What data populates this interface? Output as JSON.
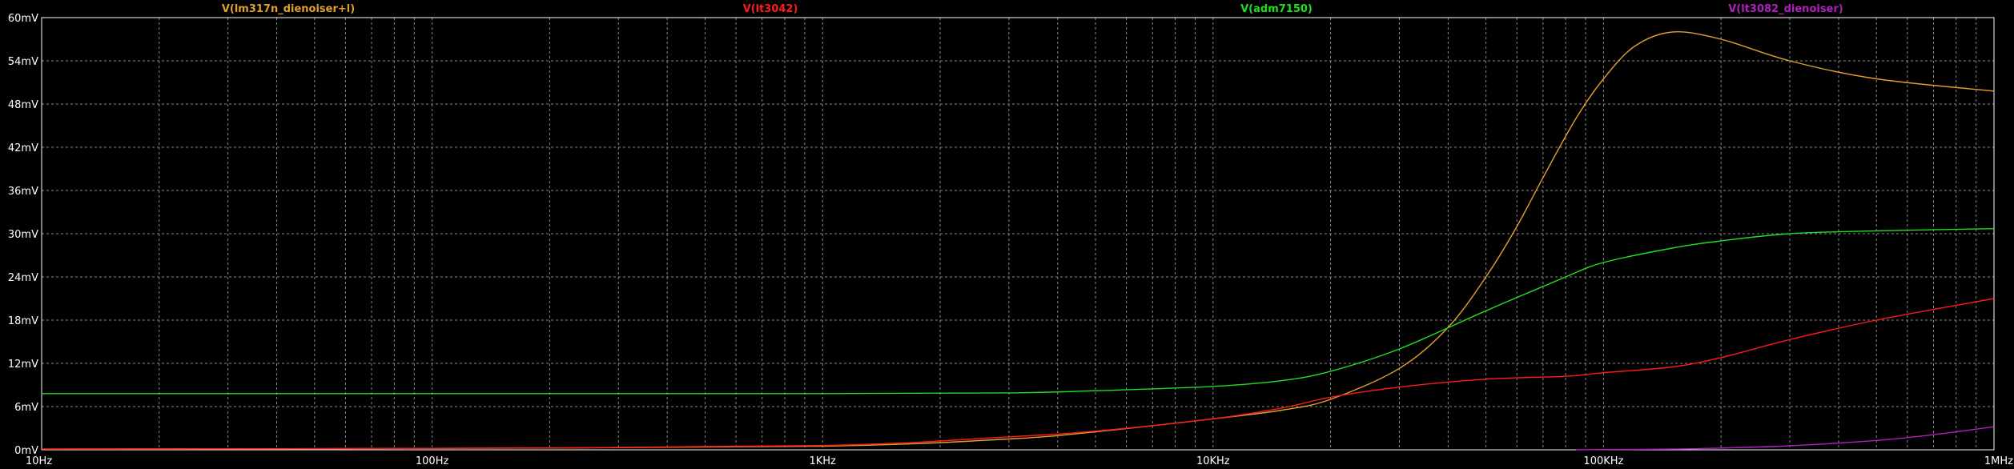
{
  "chart_data": {
    "type": "line",
    "x_scale": "log",
    "xlim": [
      10,
      1000000
    ],
    "ylim": [
      0,
      60
    ],
    "y_unit": "mV",
    "grid": true,
    "background": "#000000",
    "grid_color": "#8a8a8a",
    "axis_color": "#ffffff",
    "y_ticks": [
      {
        "value": 0,
        "label": "0mV"
      },
      {
        "value": 6,
        "label": "6mV"
      },
      {
        "value": 12,
        "label": "12mV"
      },
      {
        "value": 18,
        "label": "18mV"
      },
      {
        "value": 24,
        "label": "24mV"
      },
      {
        "value": 30,
        "label": "30mV"
      },
      {
        "value": 36,
        "label": "36mV"
      },
      {
        "value": 42,
        "label": "42mV"
      },
      {
        "value": 48,
        "label": "48mV"
      },
      {
        "value": 54,
        "label": "54mV"
      },
      {
        "value": 60,
        "label": "60mV"
      }
    ],
    "x_ticks": [
      {
        "value": 10,
        "label": "10Hz"
      },
      {
        "value": 100,
        "label": "100Hz"
      },
      {
        "value": 1000,
        "label": "1KHz"
      },
      {
        "value": 10000,
        "label": "10KHz"
      },
      {
        "value": 100000,
        "label": "100KHz"
      },
      {
        "value": 1000000,
        "label": "1MHz"
      }
    ],
    "series": [
      {
        "name": "V(lm317n_dienoiser+l)",
        "color": "#e0a030",
        "x": [
          10,
          100,
          1000,
          3000,
          5000,
          10000,
          15000,
          20000,
          30000,
          40000,
          50000,
          60000,
          70000,
          85000,
          100000,
          120000,
          150000,
          200000,
          300000,
          500000,
          1000000
        ],
        "y": [
          0.1,
          0.2,
          0.5,
          1.5,
          2.5,
          4.3,
          5.5,
          7.0,
          11.3,
          17.0,
          24.0,
          31.0,
          37.8,
          46.0,
          51.5,
          56.0,
          58.0,
          57.0,
          54.0,
          51.5,
          49.8
        ]
      },
      {
        "name": "V(lt3042)",
        "color": "#ff1a1a",
        "x": [
          10,
          100,
          1000,
          3000,
          5000,
          10000,
          15000,
          20000,
          30000,
          50000,
          80000,
          100000,
          150000,
          200000,
          300000,
          500000,
          1000000
        ],
        "y": [
          0.1,
          0.2,
          0.6,
          1.8,
          2.6,
          4.3,
          5.8,
          7.3,
          8.7,
          9.8,
          10.2,
          10.7,
          11.5,
          12.8,
          15.3,
          18.0,
          21.0
        ]
      },
      {
        "name": "V(adm7150)",
        "color": "#22dd22",
        "x": [
          10,
          100,
          1000,
          3000,
          5000,
          10000,
          15000,
          20000,
          30000,
          50000,
          80000,
          100000,
          150000,
          200000,
          300000,
          500000,
          1000000
        ],
        "y": [
          7.8,
          7.8,
          7.8,
          7.9,
          8.2,
          8.8,
          9.6,
          10.9,
          14.0,
          19.3,
          24.0,
          26.0,
          28.0,
          29.0,
          30.0,
          30.4,
          30.7
        ]
      },
      {
        "name": "V(lt3082_dienoiser)",
        "color": "#b020c0",
        "x": [
          85000,
          100000,
          150000,
          200000,
          300000,
          500000,
          700000,
          1000000
        ],
        "y": [
          0.0,
          0.03,
          0.1,
          0.25,
          0.55,
          1.3,
          2.1,
          3.2
        ]
      }
    ]
  }
}
